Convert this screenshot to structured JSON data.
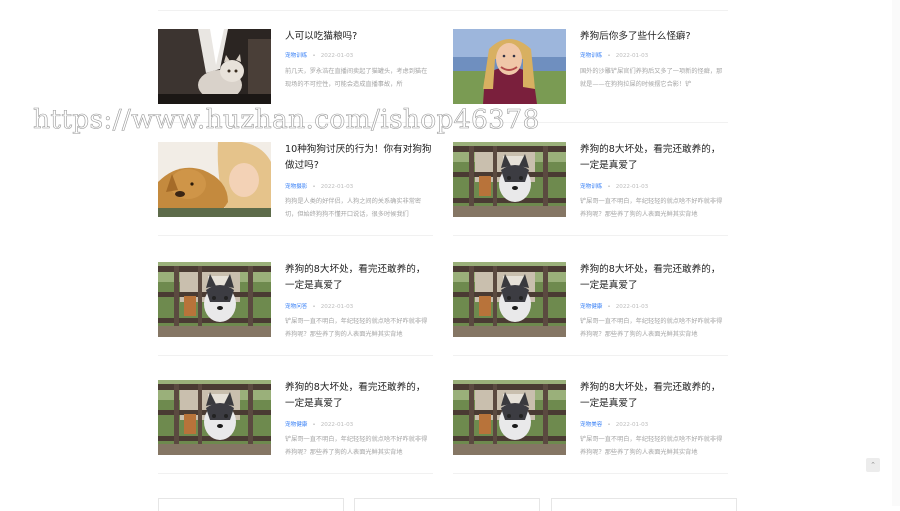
{
  "watermark": "https://www.huzhan.com/ishop46378",
  "back_to_top_icon": "chevron-up-icon",
  "accent_color": "#3b82f6",
  "articles": [
    {
      "title": "人可以吃猫粮吗?",
      "category": "宠物训练",
      "date": "2022-01-03",
      "excerpt": "前几天，罗永浩在直播间卖起了猫罐头，考虑到猫在现场的不可控性，可能会造成直播事故，所",
      "image": "cat-on-floor"
    },
    {
      "title": "养狗后你多了些什么怪癖?",
      "category": "宠物训练",
      "date": "2022-01-03",
      "excerpt": "国外的沙雕铲屎官们养狗后又多了一项新的怪癖，那就是——在狗狗拉屎的时候摆它合影！铲",
      "image": "blonde-woman-portrait"
    },
    {
      "title": "10种狗狗讨厌的行为！你有对狗狗做过吗?",
      "category": "宠物摄影",
      "date": "2022-01-03",
      "excerpt": "狗狗是人类的好伴侣，人狗之间的关系确实非常密切，但始终狗狗不懂开口说话，很多时候我们",
      "image": "woman-with-golden-dog"
    },
    {
      "title": "养狗的8大坏处，看完还敢养的，一定是真爱了",
      "category": "宠物训练",
      "date": "2022-01-03",
      "excerpt": "铲屎哥一直不明白，年纪轻轻的就点啥不好咋就非得养狗呢？那些养了狗的人表面光鲜其实背地",
      "image": "husky-behind-fence"
    },
    {
      "title": "养狗的8大坏处，看完还敢养的，一定是真爱了",
      "category": "宠物问答",
      "date": "2022-01-03",
      "excerpt": "铲屎哥一直不明白，年纪轻轻的就点啥不好咋就非得养狗呢？那些养了狗的人表面光鲜其实背地",
      "image": "husky-behind-fence"
    },
    {
      "title": "养狗的8大坏处，看完还敢养的，一定是真爱了",
      "category": "宠物健康",
      "date": "2022-01-03",
      "excerpt": "铲屎哥一直不明白，年纪轻轻的就点啥不好咋就非得养狗呢？那些养了狗的人表面光鲜其实背地",
      "image": "husky-behind-fence"
    },
    {
      "title": "养狗的8大坏处，看完还敢养的，一定是真爱了",
      "category": "宠物健康",
      "date": "2022-01-03",
      "excerpt": "铲屎哥一直不明白，年纪轻轻的就点啥不好咋就非得养狗呢？那些养了狗的人表面光鲜其实背地",
      "image": "husky-behind-fence"
    },
    {
      "title": "养狗的8大坏处，看完还敢养的，一定是真爱了",
      "category": "宠物美容",
      "date": "2022-01-03",
      "excerpt": "铲屎哥一直不明白，年纪轻轻的就点啥不好咋就非得养狗呢？那些养了狗的人表面光鲜其实背地",
      "image": "husky-behind-fence"
    }
  ]
}
